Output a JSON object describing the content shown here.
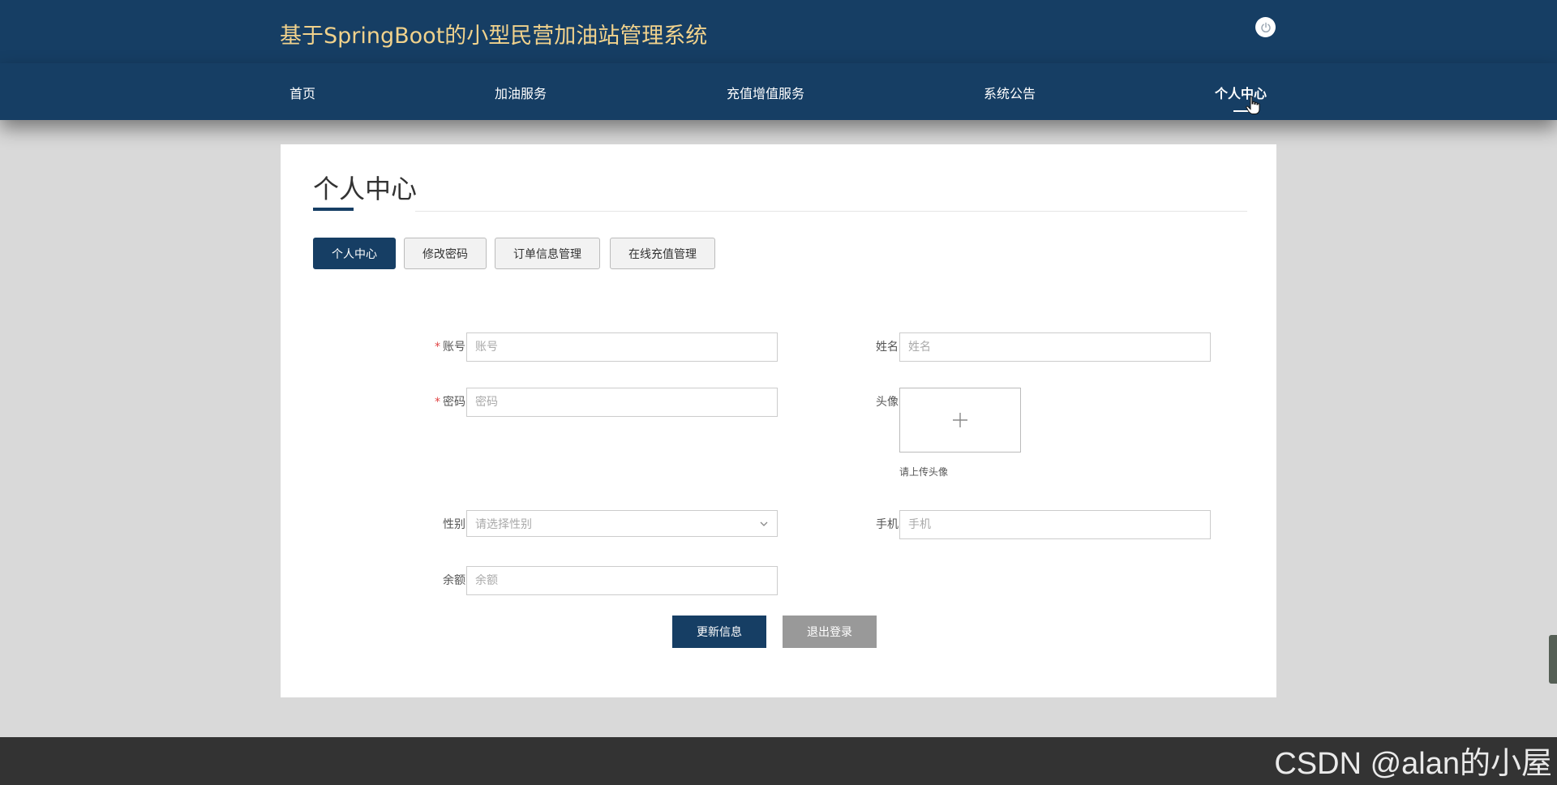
{
  "header": {
    "site_title": "基于SpringBoot的小型民营加油站管理系统"
  },
  "nav": {
    "items": [
      {
        "label": "首页"
      },
      {
        "label": "加油服务"
      },
      {
        "label": "充值增值服务"
      },
      {
        "label": "系统公告"
      },
      {
        "label": "个人中心"
      }
    ],
    "active": "个人中心"
  },
  "panel": {
    "title": "个人中心",
    "tabs": [
      {
        "label": "个人中心"
      },
      {
        "label": "修改密码"
      },
      {
        "label": "订单信息管理"
      },
      {
        "label": "在线充值管理"
      }
    ],
    "active_tab": "个人中心"
  },
  "form": {
    "required_mark": "*",
    "account": {
      "label": "账号",
      "placeholder": "账号",
      "value": ""
    },
    "name": {
      "label": "姓名",
      "placeholder": "姓名",
      "value": ""
    },
    "password": {
      "label": "密码",
      "placeholder": "密码",
      "value": ""
    },
    "avatar": {
      "label": "头像",
      "tip": "请上传头像"
    },
    "gender": {
      "label": "性别",
      "placeholder": "请选择性别"
    },
    "phone": {
      "label": "手机",
      "placeholder": "手机",
      "value": ""
    },
    "balance": {
      "label": "余额",
      "placeholder": "余额",
      "value": ""
    },
    "update_button": "更新信息",
    "logout_button": "退出登录"
  },
  "watermark": "CSDN @alan的小屋",
  "colors": {
    "header_bg": "#163e64",
    "title_gold": "#f1d28c",
    "primary": "#163e64",
    "secondary_button": "#999999",
    "page_bg": "#d9d9d9",
    "footer_bg": "#333333"
  },
  "icons": {
    "power": "power-icon",
    "plus": "plus-icon",
    "chevron": "chevron-down-icon",
    "cursor": "hand-cursor-icon"
  }
}
